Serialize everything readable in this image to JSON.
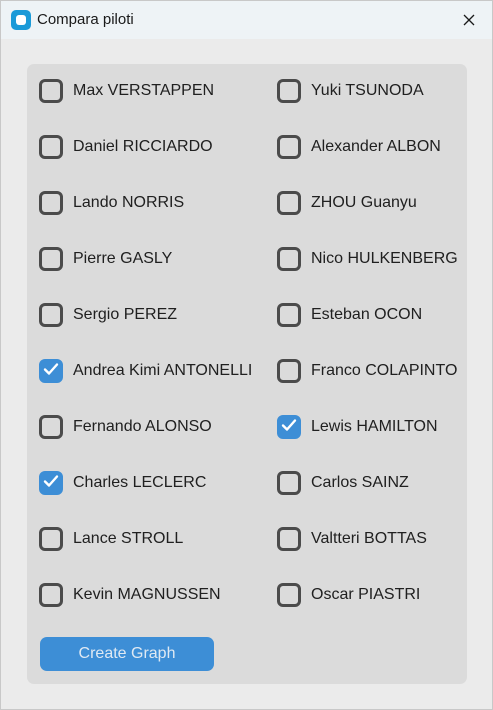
{
  "window": {
    "title": "Compara piloti",
    "icon": "app-icon",
    "close_icon": "close-icon"
  },
  "drivers_left": [
    {
      "name": "Max VERSTAPPEN",
      "checked": false
    },
    {
      "name": "Daniel RICCIARDO",
      "checked": false
    },
    {
      "name": "Lando NORRIS",
      "checked": false
    },
    {
      "name": "Pierre GASLY",
      "checked": false
    },
    {
      "name": "Sergio PEREZ",
      "checked": false
    },
    {
      "name": "Andrea Kimi ANTONELLI",
      "checked": true
    },
    {
      "name": "Fernando ALONSO",
      "checked": false
    },
    {
      "name": "Charles LECLERC",
      "checked": true
    },
    {
      "name": "Lance STROLL",
      "checked": false
    },
    {
      "name": "Kevin MAGNUSSEN",
      "checked": false
    }
  ],
  "drivers_right": [
    {
      "name": "Yuki TSUNODA",
      "checked": false
    },
    {
      "name": "Alexander ALBON",
      "checked": false
    },
    {
      "name": "ZHOU Guanyu",
      "checked": false
    },
    {
      "name": "Nico HULKENBERG",
      "checked": false
    },
    {
      "name": "Esteban OCON",
      "checked": false
    },
    {
      "name": "Franco COLAPINTO",
      "checked": false
    },
    {
      "name": "Lewis HAMILTON",
      "checked": true
    },
    {
      "name": "Carlos SAINZ",
      "checked": false
    },
    {
      "name": "Valtteri BOTTAS",
      "checked": false
    },
    {
      "name": "Oscar PIASTRI",
      "checked": false
    }
  ],
  "actions": {
    "create_graph_label": "Create Graph"
  },
  "colors": {
    "accent": "#3d8ed6",
    "checkbox_border": "#4b4b4b",
    "panel_bg": "#dbdbdb",
    "window_bg": "#ebebeb",
    "titlebar_bg": "#eef3f6"
  }
}
